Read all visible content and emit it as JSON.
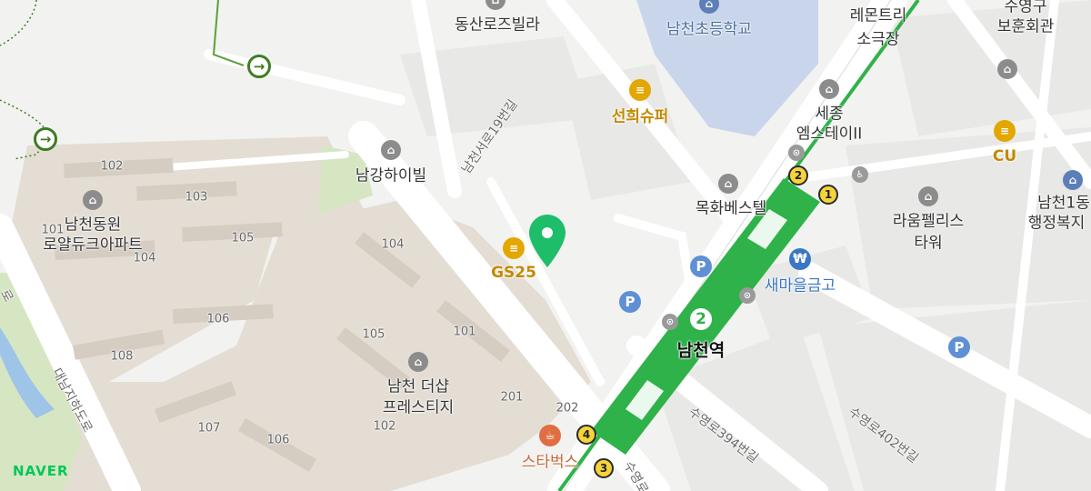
{
  "brand": {
    "logo_text": "NAVER",
    "logo_color": "#03c75a"
  },
  "colors": {
    "background": "#f2f2f0",
    "block": "#e6e6e4",
    "road": "#ffffff",
    "apartment": "#e4ddd4",
    "school_ground": "#c9d5ea",
    "park": "#d6e6c2",
    "subway_line2": "#2fb24a",
    "river": "#9ec4e8",
    "trail": "#3e7d22"
  },
  "places": {
    "dongsan_villa": "동산로즈빌라",
    "namcheon_elementary": "남천초등학교",
    "lemon_tree_theater_l1": "레몬트리",
    "lemon_tree_theater_l2": "소극장",
    "suyeonggu_hall_l1": "수영구",
    "suyeonggu_hall_l2": "보훈회관",
    "sunhee_super": "선희슈퍼",
    "sejong_ems_l1": "세종",
    "sejong_ems_l2": "엠스테이II",
    "cu": "CU",
    "namcheon_admin_l1": "남천1동",
    "namcheon_admin_l2": "행정복지",
    "namgang_hill": "남강하이빌",
    "mokhwa_best": "목화베스텔",
    "raum_palace_l1": "라움펠리스",
    "raum_palace_l2": "타워",
    "namcheon_royal_l1": "남천동원",
    "namcheon_royal_l2": "로얄듀크아파트",
    "gs25": "GS25",
    "saemaeul": "새마을금고",
    "namcheon_station": "남천역",
    "the_sharp_l1": "남천 더샵",
    "the_sharp_l2": "프레스티지",
    "starbucks": "스타벅스"
  },
  "roads": {
    "namcheonseo_19": "남천서로19번길",
    "daenamjiha": "대남지하도로",
    "suyeong_394": "수영로394번길",
    "suyeong_402": "수영로402번길",
    "suyeong_partial": "수영로",
    "edge_partial": "로"
  },
  "buildings": [
    "102",
    "103",
    "101",
    "105",
    "104",
    "104",
    "106",
    "108",
    "105",
    "101",
    "107",
    "106",
    "102",
    "201",
    "202"
  ],
  "subway": {
    "line": "2",
    "exits": [
      "1",
      "2",
      "3",
      "4"
    ]
  },
  "icons": {
    "poi": "building-icon",
    "shop": "basket-icon",
    "parking": "parking-icon",
    "bank": "won-icon",
    "cafe": "cup-icon",
    "trail_marker": "arrow-right-icon",
    "location": "location-pin-icon",
    "accessibility": "wheelchair-icon",
    "bus": "bus-stop-icon"
  },
  "glyphs": {
    "poi": "⌂",
    "shop": "≡",
    "parking": "P",
    "bank": "₩",
    "cafe": "☕",
    "arrow": "→",
    "wheelchair": "♿",
    "bus": "⊙"
  }
}
